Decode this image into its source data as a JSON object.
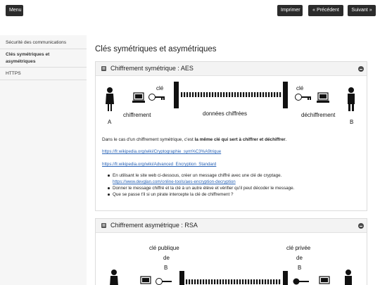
{
  "topbar": {
    "menu_label": "Menu",
    "print_label": "Imprimer",
    "prev_label": "« Précédent",
    "next_label": "Suivant »"
  },
  "sidebar": {
    "items": [
      {
        "label": "Sécurité des communications"
      },
      {
        "label_line1": "Clés symétriques et",
        "label_line2": "asymétriques"
      },
      {
        "label": "HTTPS"
      }
    ]
  },
  "page_title": "Clés symétriques et asymétriques",
  "card_sym": {
    "title": "Chiffrement symétrique : AES",
    "diagram": {
      "key_left": "clé",
      "key_right": "clé",
      "encrypt": "chiffrement",
      "data": "données chiffrées",
      "decrypt": "déchiffrement",
      "person_a": "A",
      "person_b": "B"
    },
    "text_before": "Dans le cas d'un chiffrement symétrique, c'est ",
    "text_bold": "la même clé qui sert à chiffrer et déchiffrer",
    "text_after": ".",
    "link1": "https://fr.wikipedia.org/wiki/Cryptographie_sym%C3%A9trique",
    "link2": "https://fr.wikipedia.org/wiki/Advanced_Encryption_Standard",
    "bullets": [
      "En utilisant le site web ci-dessous, créer un message chiffré avec une clé de cryptage.",
      "https://www.devglan.com/online-tools/aes-encryption-decryption",
      "Donner le message chiffré et la clé à un autre élève et vérifier qu'il peut décoder le message.",
      "Que se passe t'il si un pirate intercepte la clé de chiffrement ?"
    ]
  },
  "card_asym": {
    "title": "Chiffrement asymétrique : RSA",
    "diagram": {
      "public_line1": "clé publique",
      "public_line2": "de",
      "public_line3": "B",
      "private_line1": "clé privée",
      "private_line2": "de",
      "private_line3": "B"
    }
  },
  "icons": {
    "menu": "none",
    "card_head": "book-icon",
    "collapse": "minus-circle-icon",
    "person": "person-icon",
    "computer": "computer-icon",
    "key": "key-icon"
  },
  "colors": {
    "button_bg": "#2b2b2b",
    "link": "#2a64b7",
    "sidebar_bg": "#f6f6f6",
    "card_head_bg": "#f3f3f3"
  }
}
